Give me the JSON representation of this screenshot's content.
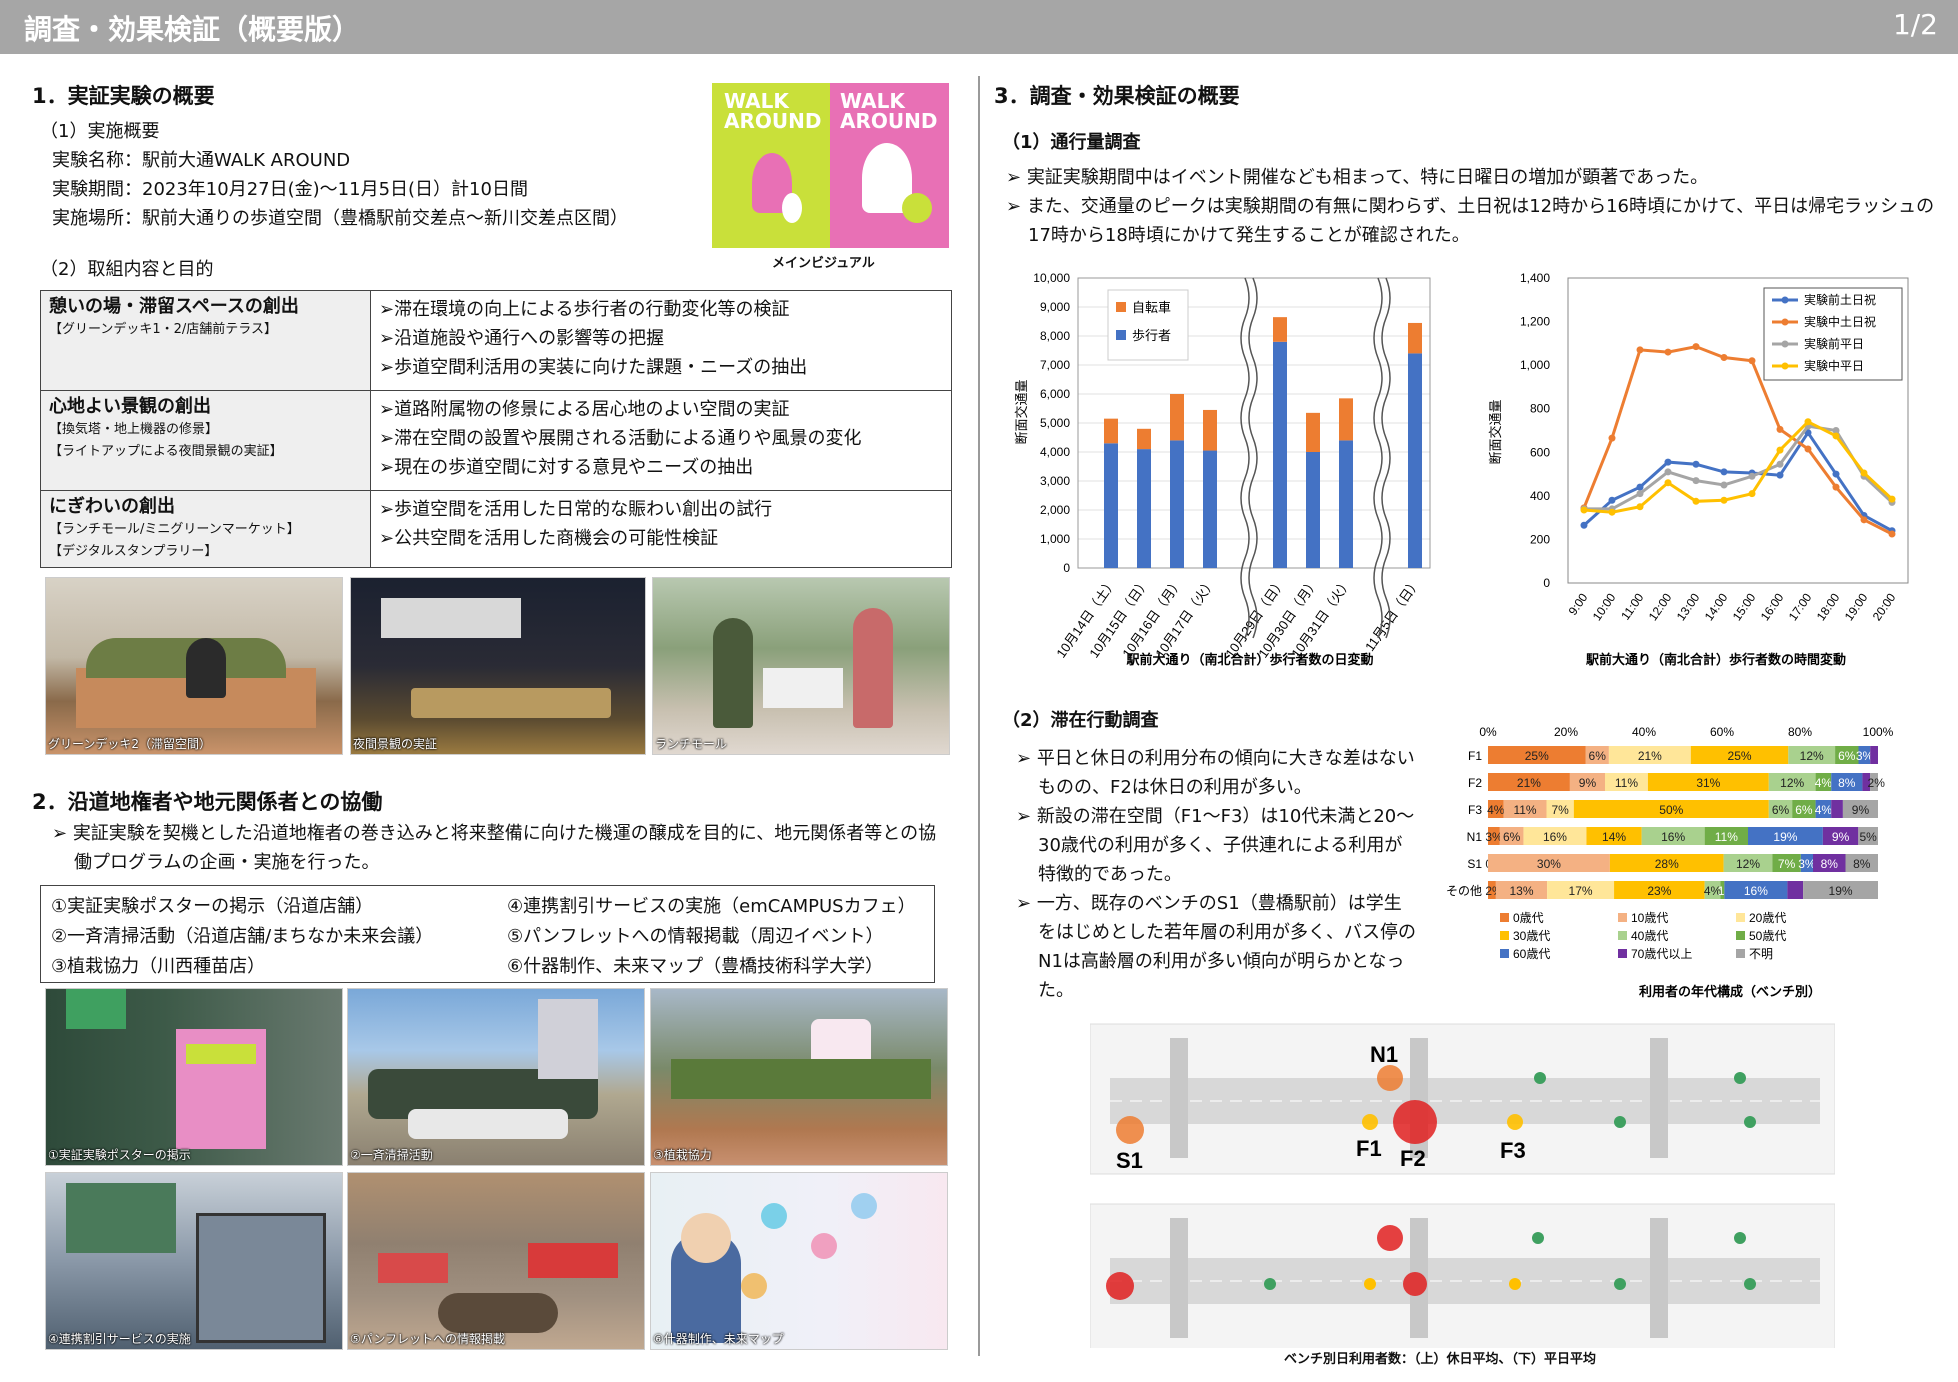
{
  "header": {
    "title": "調査・効果検証（概要版）",
    "page": "1/2"
  },
  "sec1": {
    "title": "1．実証実験の概要",
    "sub1": "（1）実施概要",
    "name": "実験名称：駅前大通WALK AROUND",
    "period": "実験期間：2023年10月27日(金)～11月5日(日）計10日間",
    "place": "実施場所：駅前大通りの歩道空間（豊橋駅前交差点～新川交差点区間）",
    "visual_caption": "メインビジュアル",
    "visual_text_left": "WALK AROUND",
    "visual_text_right": "WALK AROUND",
    "sub2": "（2）取組内容と目的",
    "goals": [
      {
        "title": "憩いの場・滞留スペースの創出",
        "sub": [
          "【グリーンデッキ1・2/店舗前テラス】"
        ],
        "items": [
          "滞在環境の向上による歩行者の行動変化等の検証",
          "沿道施設や通行への影響等の把握",
          "歩道空間利活用の実装に向けた課題・ニーズの抽出"
        ]
      },
      {
        "title": "心地よい景観の創出",
        "sub": [
          "【換気塔・地上機器の修景】",
          "【ライトアップによる夜間景観の実証】"
        ],
        "items": [
          "道路附属物の修景による居心地のよい空間の実証",
          "滞在空間の設置や展開される活動による通りや風景の変化",
          "現在の歩道空間に対する意見やニーズの抽出"
        ]
      },
      {
        "title": "にぎわいの創出",
        "sub": [
          "【ランチモール/ミニグリーンマーケット】",
          "【デジタルスタンプラリー】"
        ],
        "items": [
          "歩道空間を活用した日常的な賑わい創出の試行",
          "公共空間を活用した商機会の可能性検証"
        ]
      }
    ],
    "photos": [
      "グリーンデッキ2（滞留空間）",
      "夜間景観の実証",
      "ランチモール"
    ]
  },
  "sec2": {
    "title": "2．沿道地権者や地元関係者との協働",
    "bullet": "実証実験を契機とした沿道地権者の巻き込みと将来整備に向けた機運の醸成を目的に、地元関係者等との協働プログラムの企画・実施を行った。",
    "items": [
      "①実証実験ポスターの掲示（沿道店舗）",
      "②一斉清掃活動（沿道店舗/まちなか未来会議）",
      "③植栽協力（川西種苗店）",
      "④連携割引サービスの実施（emCAMPUSカフェ）",
      "⑤パンフレットへの情報掲載（周辺イベント）",
      "⑥什器制作、未来マップ（豊橋技術科学大学）"
    ],
    "photos": [
      "①実証実験ポスターの掲示",
      "②一斉清掃活動",
      "③植栽協力",
      "④連携割引サービスの実施",
      "⑤パンフレットへの情報掲載",
      "⑥什器制作、未来マップ"
    ]
  },
  "sec3": {
    "title": "3．調査・効果検証の概要",
    "sub1": "（1）通行量調査",
    "bullets1": [
      "実証実験期間中はイベント開催なども相まって、特に日曜日の増加が顕著であった。",
      "また、交通量のピークは実験期間の有無に関わらず、土日祝は12時から16時頃にかけて、平日は帰宅ラッシュの17時から18時頃にかけて発生することが確認された。"
    ],
    "sub2": "（2）滞在行動調査",
    "bullets2": [
      "平日と休日の利用分布の傾向に大きな差はないものの、F2は休日の利用が多い。",
      "新設の滞在空間（F1～F3）は10代未満と20～30歳代の利用が多く、子供連れによる利用が特徴的であった。",
      "一方、既存のベンチのS1（豊橋駅前）は学生をはじめとした若年層の利用が多く、バス停のN1は高齢層の利用が多い傾向が明らかとなった。"
    ],
    "map_caption": "ベンチ別日利用者数：（上）休日平均、（下）平日平均",
    "map_labels": [
      "N1",
      "S1",
      "F1",
      "F2",
      "F3"
    ]
  },
  "chart_data": [
    {
      "type": "bar",
      "title": "駅前大通り（南北合計）歩行者数の日変動",
      "ylabel": "断面交通量",
      "categories": [
        "10月14日（土）",
        "10月15日（日）",
        "10月16日（月）",
        "10月17日（火）",
        "10月29日（日）",
        "10月30日（月）",
        "10月31日（火）",
        "11月5日（日）"
      ],
      "ylim": [
        0,
        10000
      ],
      "yticks": [
        "0",
        "1,000",
        "2,000",
        "3,000",
        "4,000",
        "5,000",
        "6,000",
        "7,000",
        "8,000",
        "9,000",
        "10,000"
      ],
      "series": [
        {
          "name": "歩行者",
          "values": [
            4300,
            4100,
            4400,
            4050,
            7800,
            4000,
            4400,
            7400
          ],
          "color": "#4472c4"
        },
        {
          "name": "自転車",
          "values": [
            850,
            700,
            1600,
            1400,
            850,
            1350,
            1450,
            1050
          ],
          "color": "#ed7d31"
        }
      ],
      "legend": "top-left",
      "stacked": true
    },
    {
      "type": "line",
      "title": "駅前大通り（南北合計）歩行者数の時間変動",
      "ylabel": "断面交通量",
      "categories": [
        "9:00",
        "10:00",
        "11:00",
        "12:00",
        "13:00",
        "14:00",
        "15:00",
        "16:00",
        "17:00",
        "18:00",
        "19:00",
        "20:00"
      ],
      "ylim": [
        0,
        1400
      ],
      "yticks": [
        "0",
        "200",
        "400",
        "600",
        "800",
        "1,000",
        "1,200",
        "1,400"
      ],
      "series": [
        {
          "name": "実験前土日祝",
          "values": [
            265,
            380,
            440,
            555,
            545,
            510,
            505,
            495,
            690,
            500,
            310,
            240
          ],
          "color": "#4472c4"
        },
        {
          "name": "実験中土日祝",
          "values": [
            345,
            665,
            1070,
            1060,
            1085,
            1035,
            1020,
            705,
            615,
            440,
            290,
            225
          ],
          "color": "#ed7d31"
        },
        {
          "name": "実験前平日",
          "values": [
            340,
            340,
            410,
            510,
            470,
            450,
            490,
            545,
            720,
            700,
            490,
            370
          ],
          "color": "#a5a5a5"
        },
        {
          "name": "実験中平日",
          "values": [
            335,
            325,
            350,
            460,
            375,
            380,
            410,
            610,
            740,
            675,
            505,
            385
          ],
          "color": "#ffc000"
        }
      ],
      "legend": "top-right"
    },
    {
      "type": "bar",
      "stacked": true,
      "orientation": "horizontal",
      "title": "利用者の年代構成（ベンチ別）",
      "xticks": [
        "0%",
        "20%",
        "40%",
        "60%",
        "80%",
        "100%"
      ],
      "categories": [
        "F1",
        "F2",
        "F3",
        "N1",
        "S1",
        "その他"
      ],
      "series": [
        {
          "name": "0歳代",
          "color": "#ed7d31",
          "values": [
            25,
            21,
            4,
            3,
            0,
            2
          ]
        },
        {
          "name": "10歳代",
          "color": "#f4b183",
          "values": [
            6,
            9,
            11,
            6,
            30,
            13
          ]
        },
        {
          "name": "20歳代",
          "color": "#ffe699",
          "values": [
            21,
            11,
            7,
            16,
            0,
            17
          ]
        },
        {
          "name": "30歳代",
          "color": "#ffc000",
          "values": [
            25,
            31,
            50,
            14,
            28,
            23
          ]
        },
        {
          "name": "40歳代",
          "color": "#a9d18e",
          "values": [
            12,
            12,
            6,
            16,
            12,
            4
          ]
        },
        {
          "name": "50歳代",
          "color": "#70ad47",
          "values": [
            6,
            4,
            6,
            11,
            7,
            1
          ]
        },
        {
          "name": "60歳代",
          "color": "#4472c4",
          "values": [
            3,
            8,
            4,
            19,
            3,
            16
          ]
        },
        {
          "name": "70歳代以上",
          "color": "#7030a0",
          "values": [
            2,
            2,
            3,
            9,
            8,
            4
          ]
        },
        {
          "name": "不明",
          "color": "#a5a5a5",
          "values": [
            0,
            2,
            9,
            5,
            8,
            19
          ]
        }
      ],
      "labels": [
        [
          "25%",
          "6%",
          "21%",
          "25%",
          "12%",
          "6%",
          "3%",
          "",
          ""
        ],
        [
          "21%",
          "9%",
          "11%",
          "31%",
          "12%",
          "4%",
          "8%",
          "",
          "2%"
        ],
        [
          "4%",
          "11%",
          "7%",
          "50%",
          "6%",
          "6%",
          "4%",
          "",
          "9%"
        ],
        [
          "3%",
          "6%",
          "16%",
          "14%",
          "16%",
          "11%",
          "19%",
          "9%",
          "5%"
        ],
        [
          "0%",
          "30%",
          "",
          "28%",
          "12%",
          "7%",
          "3%",
          "8%",
          "8%"
        ],
        [
          "2%",
          "13%",
          "17%",
          "23%",
          "4%",
          "1%",
          "16%",
          "",
          "19%"
        ]
      ]
    }
  ]
}
